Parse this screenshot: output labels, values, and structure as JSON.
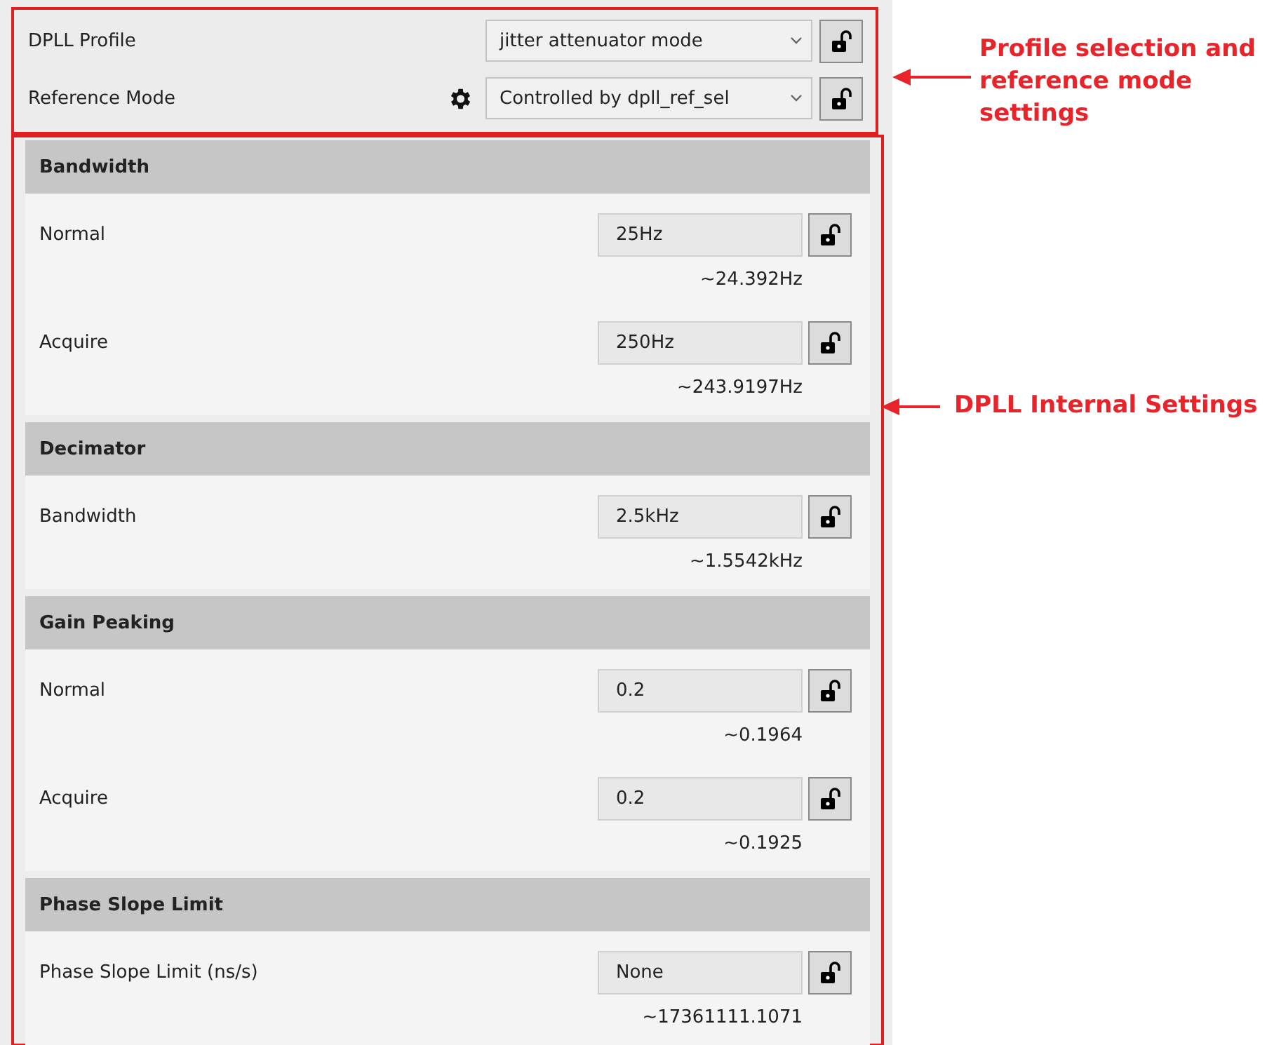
{
  "profile": [
    {
      "label": "DPLL Profile",
      "value": "jitter attenuator mode",
      "gear": false,
      "locked": false
    },
    {
      "label": "Reference Mode",
      "value": "Controlled by dpll_ref_sel",
      "gear": true,
      "locked": false
    }
  ],
  "sections": [
    {
      "title": "Bandwidth",
      "rows": [
        {
          "label": "Normal",
          "value": "25Hz",
          "approx": "~24.392Hz",
          "locked": false
        },
        {
          "label": "Acquire",
          "value": "250Hz",
          "approx": "~243.9197Hz",
          "locked": false
        }
      ]
    },
    {
      "title": "Decimator",
      "rows": [
        {
          "label": "Bandwidth",
          "value": "2.5kHz",
          "approx": "~1.5542kHz",
          "locked": false
        }
      ]
    },
    {
      "title": "Gain Peaking",
      "rows": [
        {
          "label": "Normal",
          "value": "0.2",
          "approx": "~0.1964",
          "locked": false
        },
        {
          "label": "Acquire",
          "value": "0.2",
          "approx": "~0.1925",
          "locked": false
        }
      ]
    },
    {
      "title": "Phase Slope Limit",
      "rows": [
        {
          "label": "Phase Slope Limit (ns/s)",
          "value": "None",
          "approx": "~17361111.1071",
          "locked": false
        }
      ]
    }
  ],
  "annotations": [
    {
      "text": "Profile selection and reference mode settings"
    },
    {
      "text": "DPLL Internal Settings"
    }
  ]
}
